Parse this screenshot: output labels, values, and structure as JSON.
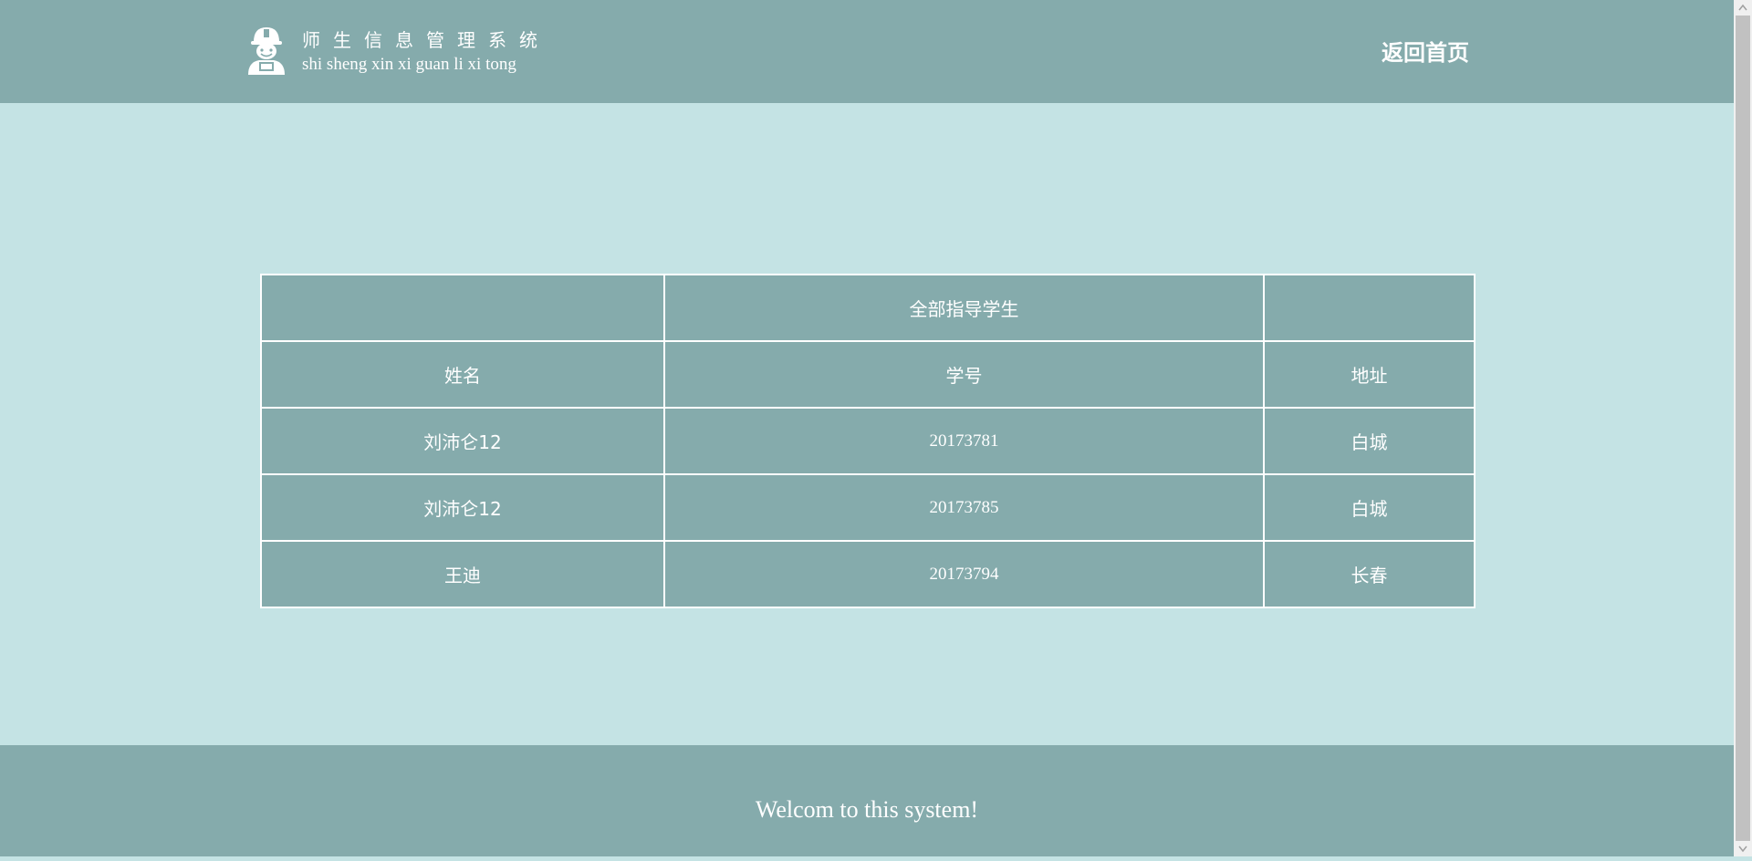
{
  "header": {
    "title_zh": "师生信息管理系统",
    "title_en": "shi sheng xin xi guan li xi tong",
    "logo_icon": "worker-avatar-icon",
    "home_link": "返回首页"
  },
  "table": {
    "caption": "全部指导学生",
    "columns": [
      "姓名",
      "学号",
      "地址"
    ],
    "rows": [
      {
        "name": "刘沛仑12",
        "id": "20173781",
        "address": "白城"
      },
      {
        "name": "刘沛仑12",
        "id": "20173785",
        "address": "白城"
      },
      {
        "name": "王迪",
        "id": "20173794",
        "address": "长春"
      }
    ]
  },
  "footer": {
    "text": "Welcom to this system!"
  },
  "colors": {
    "header_bg": "#85abac",
    "page_bg": "#c4e3e4",
    "text": "#ffffff"
  }
}
